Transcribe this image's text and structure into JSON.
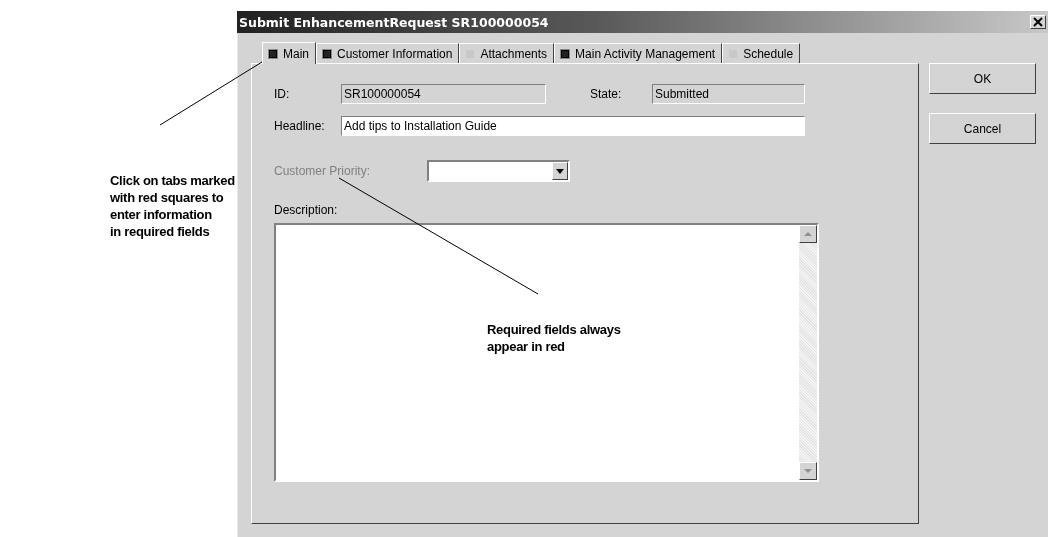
{
  "annotations": [
    {
      "lines": [
        "Click on tabs marked",
        "with red squares to",
        "enter information",
        "in required fields"
      ]
    },
    {
      "lines": [
        "Required fields always",
        "appear in red"
      ]
    }
  ],
  "window": {
    "title": "Submit EnhancementRequest SR100000054"
  },
  "tabs": [
    {
      "label": "Main",
      "selected": true,
      "required": true
    },
    {
      "label": "Customer Information",
      "selected": false,
      "required": true
    },
    {
      "label": "Attachments",
      "selected": false,
      "required": false
    },
    {
      "label": "Main Activity Management",
      "selected": false,
      "required": true
    },
    {
      "label": "Schedule",
      "selected": false,
      "required": false
    }
  ],
  "form": {
    "id": {
      "label": "ID:",
      "value": "SR100000054"
    },
    "state": {
      "label": "State:",
      "value": "Submitted"
    },
    "headline": {
      "label": "Headline:",
      "value": "Add tips to Installation Guide"
    },
    "customer_priority": {
      "label": "Customer Priority:",
      "required": true
    },
    "description": {
      "label": "Description:"
    }
  },
  "buttons": [
    "OK",
    "Cancel"
  ]
}
